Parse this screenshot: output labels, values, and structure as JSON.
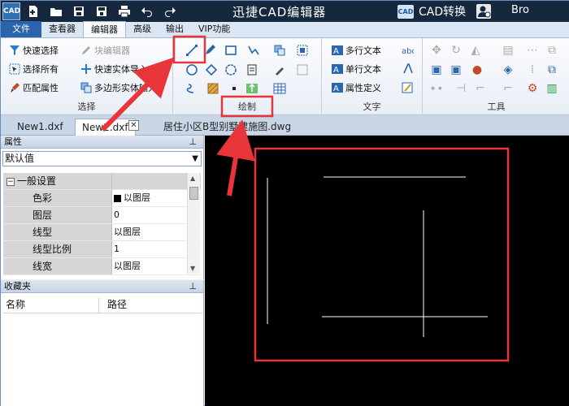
{
  "titlebar": {
    "app_icon": "CAD",
    "title": "迅捷CAD编辑器",
    "cad_convert_logo": "CAD",
    "cad_convert_label": "CAD转换",
    "user_name": "Bro",
    "quick_access_icons": [
      "new-file-icon",
      "open-folder-icon",
      "save-icon",
      "save-as-icon",
      "print-icon",
      "undo-icon",
      "redo-icon"
    ]
  },
  "menu": {
    "tabs": [
      "文件",
      "查看器",
      "编辑器",
      "高级",
      "输出",
      "VIP功能"
    ],
    "active": "编辑器"
  },
  "ribbon": {
    "select_group": {
      "label": "选择",
      "quick_select": "快速选择",
      "select_all": "选择所有",
      "match_props": "匹配属性",
      "block_editor": "块编辑器",
      "quick_solid_import": "快速实体导入",
      "polygon_solid_input": "多边形实体输入"
    },
    "draw_group": {
      "label": "绘制"
    },
    "text_group": {
      "label": "文字",
      "mtext": "多行文本",
      "stext": "单行文本",
      "attr_def": "属性定义"
    },
    "tools_group": {
      "label": "工具"
    }
  },
  "doc_tabs": {
    "tabs": [
      "New1.dxf",
      "New2.dxf",
      "居住小区B型别墅建施图.dwg"
    ],
    "active": "New2.dxf",
    "close_glyph": "✕"
  },
  "properties": {
    "title": "属性",
    "pin": "⊥",
    "combo_value": "默认值",
    "section": "一般设置",
    "rows": [
      {
        "key": "色彩",
        "value": "以图层"
      },
      {
        "key": "图层",
        "value": "0"
      },
      {
        "key": "线型",
        "value": "以图层"
      },
      {
        "key": "线型比例",
        "value": "1"
      },
      {
        "key": "线宽",
        "value": "以图层"
      }
    ]
  },
  "favorites": {
    "title": "收藏夹",
    "pin": "⊥",
    "col_name": "名称",
    "col_path": "路径"
  },
  "colors": {
    "titlebar": "#16283e",
    "file_tab": "#2a64ad",
    "canvas": "#000000",
    "annotation": "#e8353a"
  }
}
